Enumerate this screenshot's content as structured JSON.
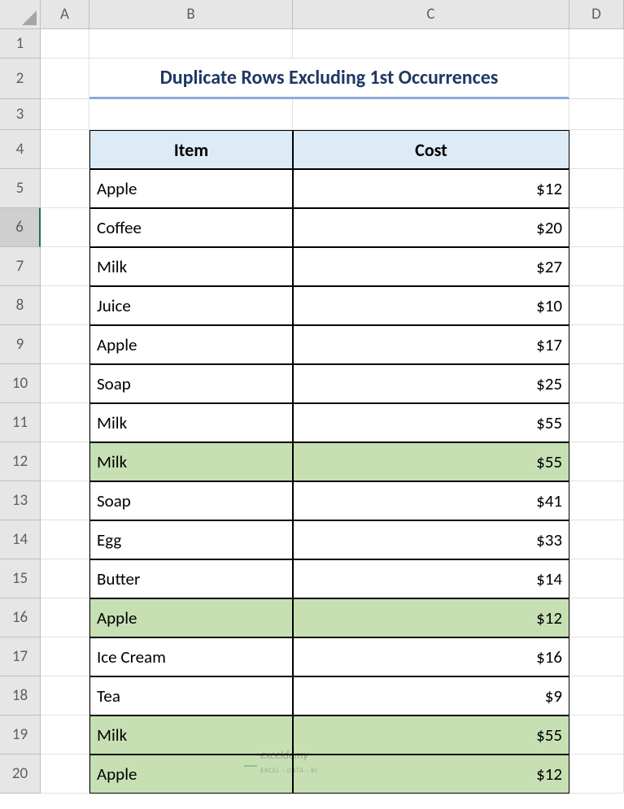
{
  "columns": [
    "A",
    "B",
    "C",
    "D"
  ],
  "row_numbers": [
    1,
    2,
    3,
    4,
    5,
    6,
    7,
    8,
    9,
    10,
    11,
    12,
    13,
    14,
    15,
    16,
    17,
    18,
    19,
    20
  ],
  "selected_row": 6,
  "title": "Duplicate Rows Excluding 1st Occurrences",
  "headers": {
    "col_b": "Item",
    "col_c": "Cost"
  },
  "table": {
    "rows": [
      {
        "item": "Apple",
        "cost": "$12",
        "dup": false
      },
      {
        "item": "Coffee",
        "cost": "$20",
        "dup": false
      },
      {
        "item": "Milk",
        "cost": "$27",
        "dup": false
      },
      {
        "item": "Juice",
        "cost": "$10",
        "dup": false
      },
      {
        "item": "Apple",
        "cost": "$17",
        "dup": false
      },
      {
        "item": "Soap",
        "cost": "$25",
        "dup": false
      },
      {
        "item": "Milk",
        "cost": "$55",
        "dup": false
      },
      {
        "item": "Milk",
        "cost": "$55",
        "dup": true
      },
      {
        "item": "Soap",
        "cost": "$41",
        "dup": false
      },
      {
        "item": "Egg",
        "cost": "$33",
        "dup": false
      },
      {
        "item": "Butter",
        "cost": "$14",
        "dup": false
      },
      {
        "item": "Apple",
        "cost": "$12",
        "dup": true
      },
      {
        "item": "Ice Cream",
        "cost": "$16",
        "dup": false
      },
      {
        "item": "Tea",
        "cost": "$9",
        "dup": false
      },
      {
        "item": "Milk",
        "cost": "$55",
        "dup": true
      },
      {
        "item": "Apple",
        "cost": "$12",
        "dup": true
      }
    ]
  },
  "watermark": {
    "text": "exceldemy",
    "sub": "EXCEL · DATA · BI"
  },
  "chart_data": {
    "type": "table",
    "title": "Duplicate Rows Excluding 1st Occurrences",
    "columns": [
      "Item",
      "Cost"
    ],
    "rows": [
      [
        "Apple",
        12
      ],
      [
        "Coffee",
        20
      ],
      [
        "Milk",
        27
      ],
      [
        "Juice",
        10
      ],
      [
        "Apple",
        17
      ],
      [
        "Soap",
        25
      ],
      [
        "Milk",
        55
      ],
      [
        "Milk",
        55
      ],
      [
        "Soap",
        41
      ],
      [
        "Egg",
        33
      ],
      [
        "Butter",
        14
      ],
      [
        "Apple",
        12
      ],
      [
        "Ice Cream",
        16
      ],
      [
        "Tea",
        9
      ],
      [
        "Milk",
        55
      ],
      [
        "Apple",
        12
      ]
    ]
  }
}
